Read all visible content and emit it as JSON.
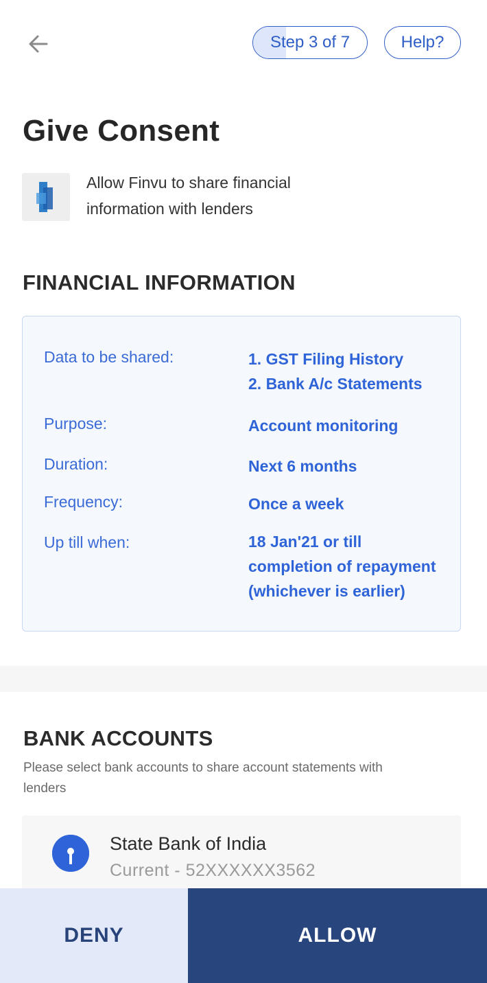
{
  "header": {
    "back_icon": "arrow-left-icon",
    "step_label": "Step 3 of 7",
    "step_progress": 0.29,
    "help_label": "Help?"
  },
  "title": "Give Consent",
  "consent": {
    "logo_icon": "finvu-logo-icon",
    "description": "Allow Finvu to share financial information with lenders"
  },
  "financial": {
    "title": "FINANCIAL INFORMATION",
    "rows": [
      {
        "label": "Data to be shared:",
        "values": [
          "1. GST Filing History",
          "2. Bank A/c Statements"
        ]
      },
      {
        "label": "Purpose:",
        "values": [
          "Account monitoring"
        ]
      },
      {
        "label": "Duration:",
        "values": [
          "Next 6 months"
        ]
      },
      {
        "label": "Frequency:",
        "values": [
          "Once a week"
        ]
      },
      {
        "label": "Up till when:",
        "values": [
          "18 Jan'21 or till",
          "completion of repayment",
          "(whichever is earlier)"
        ]
      }
    ]
  },
  "bank_accounts": {
    "title": "BANK ACCOUNTS",
    "description": "Please select bank accounts to share account statements with lenders",
    "items": [
      {
        "logo_icon": "sbi-logo-icon",
        "name": "State Bank of India",
        "account": "Current - 52XXXXXX3562"
      }
    ]
  },
  "footer": {
    "deny_label": "DENY",
    "allow_label": "ALLOW"
  },
  "colors": {
    "primary": "#2f5ec7",
    "dark_blue": "#28457d",
    "light_blue": "#e3e9f9"
  }
}
